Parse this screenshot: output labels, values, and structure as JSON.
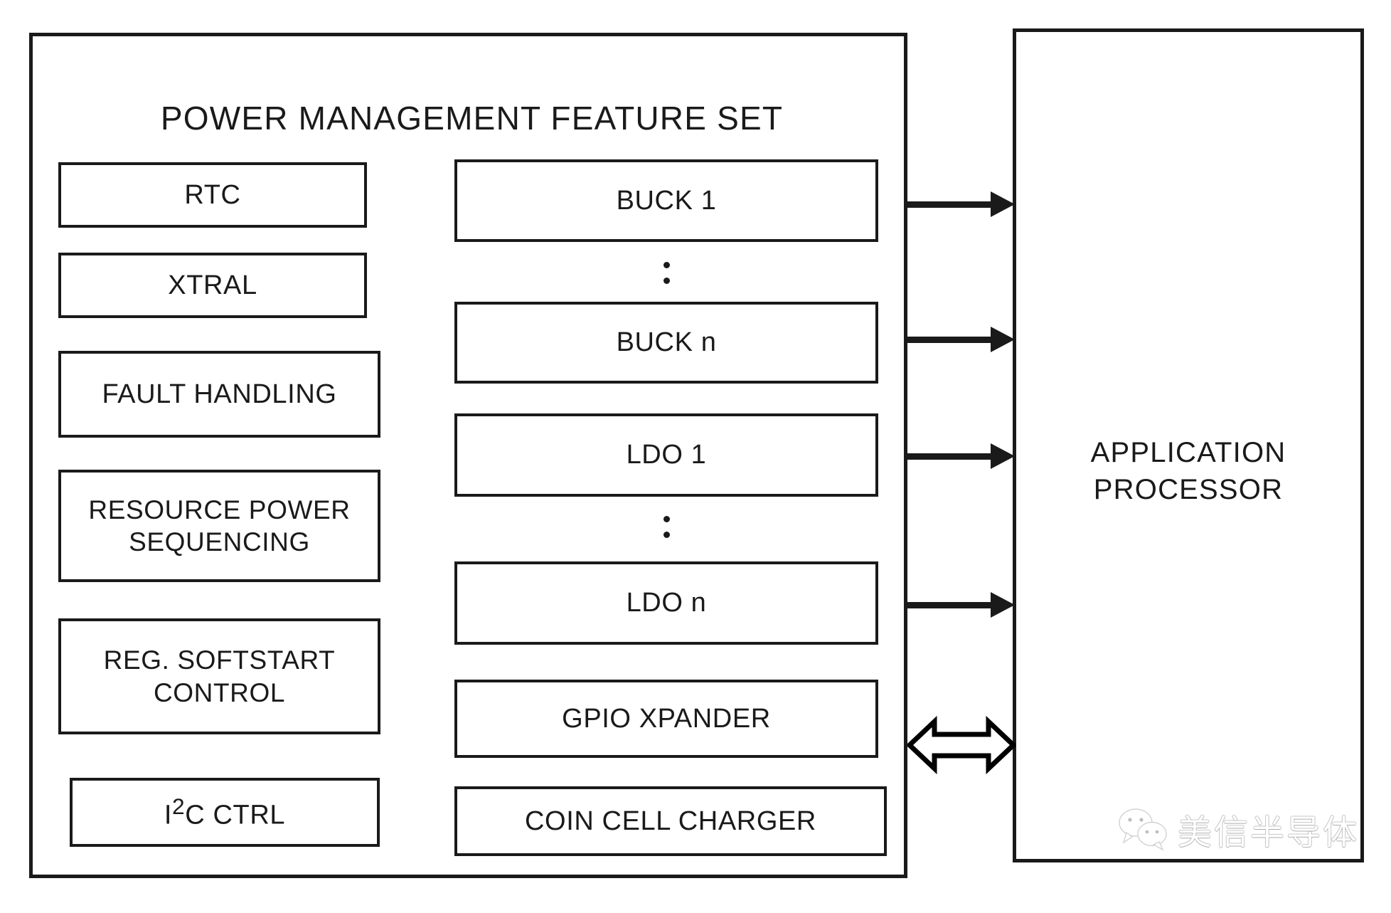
{
  "pmic": {
    "title": "POWER MANAGEMENT FEATURE SET",
    "left_column": [
      {
        "label": "RTC"
      },
      {
        "label": "XTRAL"
      },
      {
        "label": "FAULT HANDLING"
      },
      {
        "label": "RESOURCE POWER SEQUENCING"
      },
      {
        "label": "REG. SOFTSTART CONTROL"
      },
      {
        "label": "I2C CTRL",
        "html": "I<sup>2</sup>C CTRL"
      }
    ],
    "right_column": [
      {
        "label": "BUCK 1"
      },
      {
        "label": "BUCK n"
      },
      {
        "label": "LDO 1"
      },
      {
        "label": "LDO n"
      },
      {
        "label": "GPIO XPANDER"
      },
      {
        "label": "COIN CELL CHARGER"
      }
    ],
    "ellipsis_symbol": "⋮"
  },
  "processor": {
    "title": "APPLICATION PROCESSOR"
  },
  "connections": {
    "rail_arrows": [
      {
        "name": "buck1-to-ap",
        "direction": "right"
      },
      {
        "name": "buckn-to-ap",
        "direction": "right"
      },
      {
        "name": "ldo1-to-ap",
        "direction": "right"
      },
      {
        "name": "ldon-to-ap",
        "direction": "right"
      }
    ],
    "bus_arrow": {
      "name": "i2c-bus",
      "direction": "bidirectional"
    }
  },
  "watermark": {
    "text": "美信半导体",
    "icon": "wechat-logo"
  },
  "colors": {
    "stroke": "#1a1a1a",
    "background": "#ffffff"
  }
}
